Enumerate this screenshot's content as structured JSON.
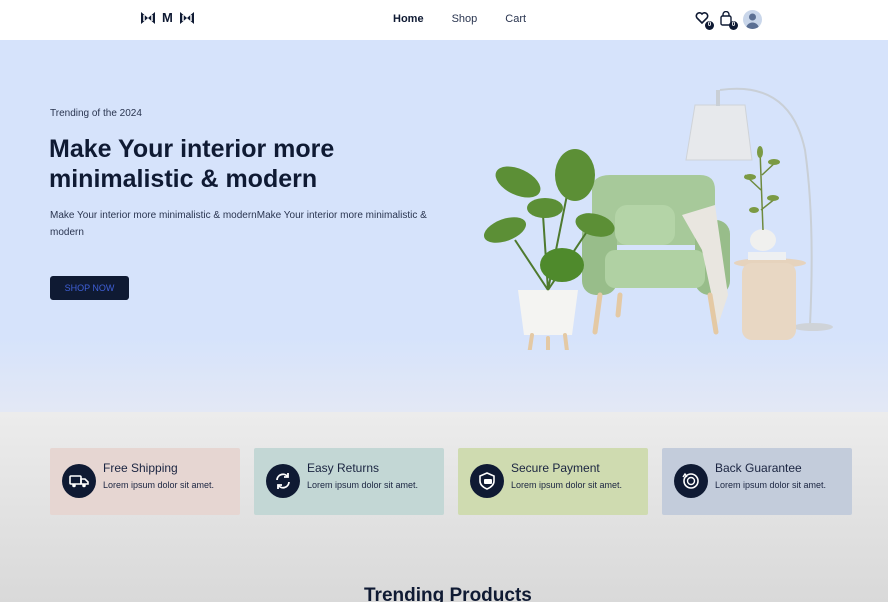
{
  "header": {
    "logo_text": "M",
    "nav": [
      {
        "label": "Home",
        "active": true
      },
      {
        "label": "Shop",
        "active": false
      },
      {
        "label": "Cart",
        "active": false
      }
    ],
    "wishlist_count": "0",
    "cart_count": "0"
  },
  "hero": {
    "trending_label": "Trending of the 2024",
    "title": "Make Your interior more minimalistic & modern",
    "description": "Make Your interior more minimalistic & modernMake Your interior more minimalistic & modern",
    "cta_label": "SHOP NOW"
  },
  "features": [
    {
      "title": "Free Shipping",
      "text": "Lorem ipsum dolor sit amet.",
      "icon": "truck-icon",
      "color": "#e6d6d2"
    },
    {
      "title": "Easy Returns",
      "text": "Lorem ipsum dolor sit amet.",
      "icon": "refresh-icon",
      "color": "#c3d7d5"
    },
    {
      "title": "Secure Payment",
      "text": "Lorem ipsum dolor sit amet.",
      "icon": "shield-card-icon",
      "color": "#cfdbb0"
    },
    {
      "title": "Back Guarantee",
      "text": "Lorem ipsum dolor sit amet.",
      "icon": "money-back-icon",
      "color": "#c3ccdb"
    }
  ],
  "section": {
    "trending_title": "Trending Products"
  },
  "colors": {
    "brand_dark": "#0f1a33",
    "hero_bg": "#d6e3fb",
    "cta_text": "#3f5fd6"
  }
}
